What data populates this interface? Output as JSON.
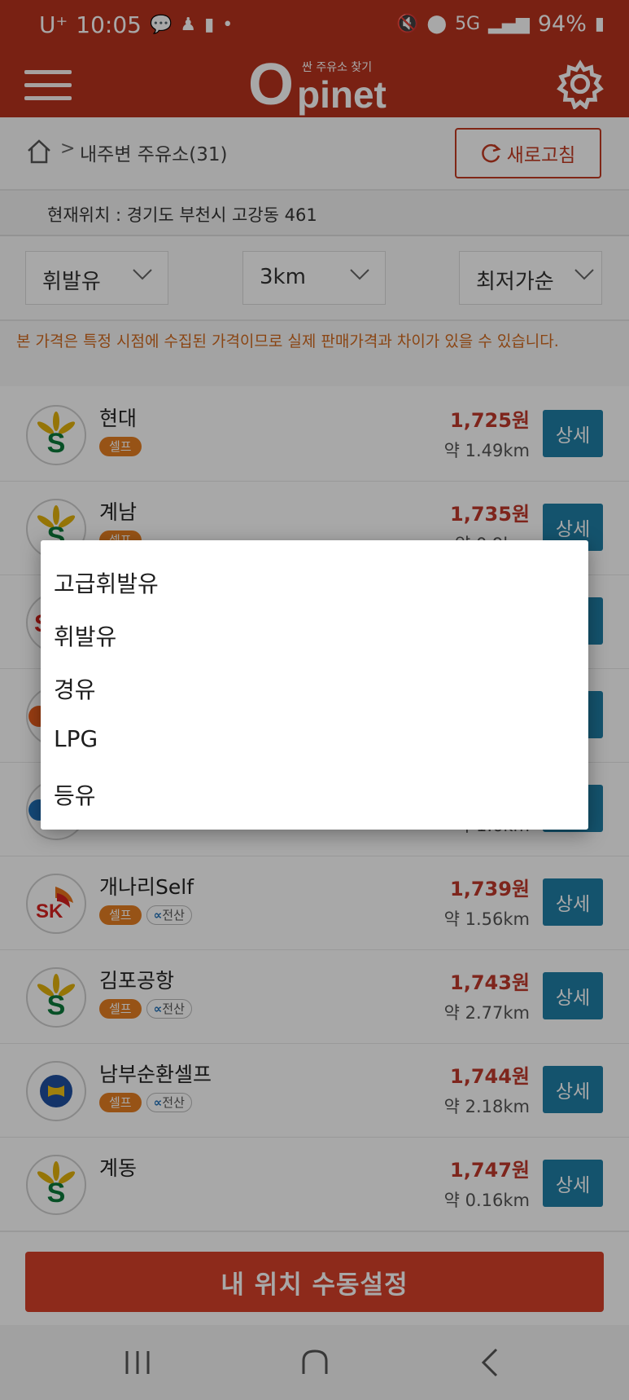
{
  "status_bar": {
    "carrier": "U⁺",
    "time": "10:05",
    "battery": "94%"
  },
  "app": {
    "logo_o": "O",
    "logo_rest": "pinet",
    "logo_sub": "싼 주유소 찾기"
  },
  "breadcrumb": {
    "separator": ">",
    "label": "내주변 주유소(31)",
    "refresh_label": "새로고침"
  },
  "location": {
    "text": "현재위치 : 경기도 부천시 고강동 461"
  },
  "filters": {
    "fuel": "휘발유",
    "radius": "3km",
    "sort": "최저가순"
  },
  "notice": "본 가격은 특정 시점에 수집된 가격이므로 실제 판매가격과 차이가 있을 수 있습니다.",
  "stations": [
    {
      "name": "현대",
      "tag_self": "셀프",
      "price": "1,725원",
      "distance": "약 1.49km",
      "detail": "상세"
    },
    {
      "name": "계남",
      "tag_self": "셀프",
      "price": "1,735원",
      "distance": "약 0.9km",
      "detail": "상세"
    },
    {
      "name": "",
      "price": "",
      "distance": "",
      "detail": "상세"
    },
    {
      "name": "",
      "price": "",
      "distance": "",
      "detail": "상세"
    },
    {
      "name": "",
      "price": "",
      "distance": "약 1.6km",
      "detail": "상세"
    },
    {
      "name": "개나리Self",
      "tag_self": "셀프",
      "tag_card": "전산",
      "price": "1,739원",
      "distance": "약 1.56km",
      "detail": "상세"
    },
    {
      "name": "김포공항",
      "tag_self": "셀프",
      "tag_card": "전산",
      "price": "1,743원",
      "distance": "약 2.77km",
      "detail": "상세"
    },
    {
      "name": "남부순환셀프",
      "tag_self": "셀프",
      "tag_card": "전산",
      "price": "1,744원",
      "distance": "약 2.18km",
      "detail": "상세"
    },
    {
      "name": "계동",
      "price": "1,747원",
      "distance": "약 0.16km",
      "detail": "상세"
    }
  ],
  "manual_location_button": "내 위치 수동설정",
  "fuel_dialog": {
    "options": [
      "고급휘발유",
      "휘발유",
      "경유",
      "LPG",
      "등유"
    ]
  },
  "colors": {
    "brand_red": "#b8331d",
    "detail_blue": "#1f7fa6",
    "price_red": "#c0392b",
    "self_orange": "#e67e22"
  }
}
